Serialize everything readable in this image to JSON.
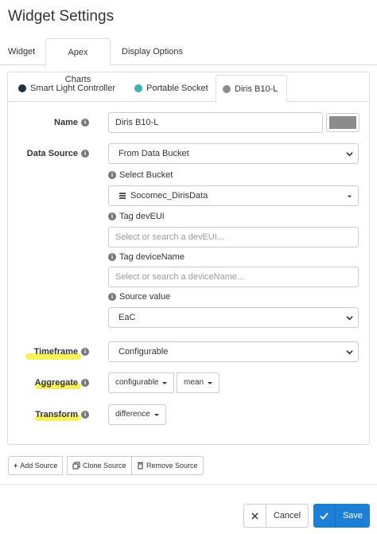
{
  "dialog": {
    "title": "Widget Settings"
  },
  "top_tabs": [
    {
      "label": "Widget"
    },
    {
      "label": "Apex Charts",
      "active": true
    },
    {
      "label": "Display Options"
    }
  ],
  "series_tabs": [
    {
      "label": "Smart Light Controller",
      "color": "#22313f"
    },
    {
      "label": "Portable Socket",
      "color": "#3bb3b3"
    },
    {
      "label": "Diris B10-L",
      "color": "#8c8c8c",
      "active": true
    }
  ],
  "form": {
    "name": {
      "label": "Name",
      "value": "Diris B10-L",
      "color": "#8c8c8c"
    },
    "data_source": {
      "label": "Data Source",
      "value": "From Data Bucket"
    },
    "select_bucket": {
      "label": "Select Bucket",
      "value": "Socomec_DirisData"
    },
    "tag_deveui": {
      "label": "Tag devEUI",
      "placeholder": "Select or search a devEUI..."
    },
    "tag_devicename": {
      "label": "Tag deviceName",
      "placeholder": "Select or search a deviceName..."
    },
    "source_value": {
      "label": "Source value",
      "value": "EaC"
    },
    "timeframe": {
      "label": "Timeframe",
      "value": "Configurable"
    },
    "aggregate": {
      "label": "Aggregate",
      "option1": "configurable",
      "option2": "mean"
    },
    "transform": {
      "label": "Transform",
      "value": "difference"
    }
  },
  "source_actions": {
    "add": "Add Source",
    "clone": "Clone Source",
    "remove": "Remove Source"
  },
  "footer": {
    "cancel": "Cancel",
    "save": "Save"
  },
  "colors": {
    "highlight": "#f5f14a",
    "primary": "#1e7fd6"
  }
}
